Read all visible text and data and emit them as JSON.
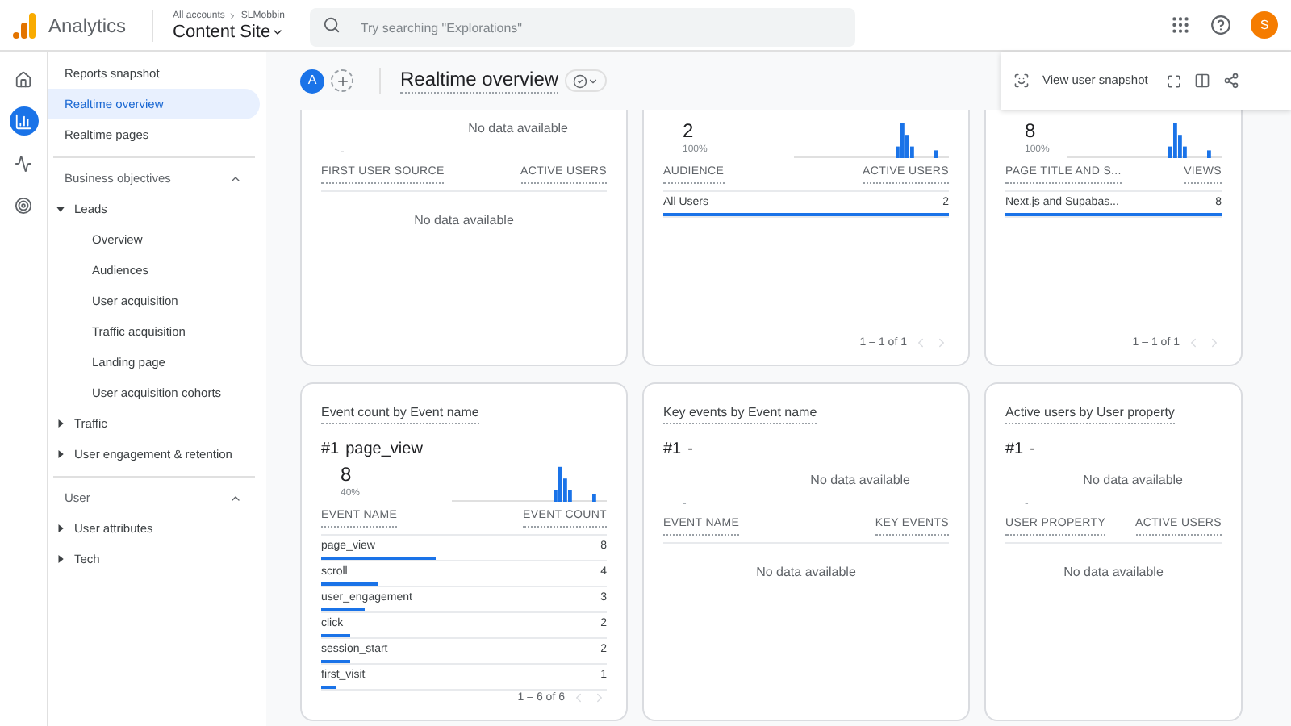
{
  "topbar": {
    "product": "Analytics",
    "breadcrumb": [
      "All accounts",
      "SLMobbin"
    ],
    "property": "Content Site",
    "search": {
      "placeholder": "Try searching \"Explorations\""
    },
    "avatar": "S"
  },
  "rail": [
    {
      "kind": "home",
      "selected": false
    },
    {
      "kind": "reports",
      "selected": true
    },
    {
      "kind": "explore",
      "selected": false
    },
    {
      "kind": "advertising",
      "selected": false
    }
  ],
  "sidebar": {
    "links": [
      {
        "label": "Reports snapshot",
        "selected": false
      },
      {
        "label": "Realtime overview",
        "selected": true
      },
      {
        "label": "Realtime pages",
        "selected": false
      }
    ],
    "sections": [
      {
        "title": "Business objectives",
        "expanded": true,
        "groups": [
          {
            "label": "Leads",
            "expanded": true,
            "children": [
              "Overview",
              "Audiences",
              "User acquisition",
              "Traffic acquisition",
              "Landing page",
              "User acquisition cohorts"
            ]
          },
          {
            "label": "Traffic",
            "expanded": false
          },
          {
            "label": "User engagement & retention",
            "expanded": false
          }
        ]
      },
      {
        "title": "User",
        "expanded": true,
        "groups": [
          {
            "label": "User attributes",
            "expanded": false
          },
          {
            "label": "Tech",
            "expanded": false
          }
        ]
      }
    ]
  },
  "header": {
    "comparison": "A",
    "title": "Realtime overview",
    "action": "View user snapshot"
  },
  "top_cards": [
    {
      "value": "-",
      "note": "No data available",
      "columns": [
        "FIRST USER SOURCE",
        "ACTIVE USERS"
      ],
      "empty": "No data available"
    },
    {
      "value": "2",
      "percent": "100%",
      "columns": [
        "AUDIENCE",
        "ACTIVE USERS"
      ],
      "rows": [
        {
          "label": "All Users",
          "value": "2",
          "level": 1
        }
      ],
      "pagination": "1 – 1 of 1"
    },
    {
      "value": "8",
      "percent": "100%",
      "columns": [
        "PAGE TITLE AND S...",
        "VIEWS"
      ],
      "rows": [
        {
          "label": "Next.js and Supabas...",
          "value": "8",
          "level": 1
        }
      ],
      "pagination": "1 – 1 of 1"
    }
  ],
  "bottom_cards": [
    {
      "title": "Event count by Event name",
      "rank": "#1",
      "rank_label": "page_view",
      "value": "8",
      "percent": "40%",
      "columns": [
        "EVENT NAME",
        "EVENT COUNT"
      ],
      "rows": [
        {
          "label": "page_view",
          "value": "8",
          "level": 0.4
        },
        {
          "label": "scroll",
          "value": "4",
          "level": 0.2
        },
        {
          "label": "user_engagement",
          "value": "3",
          "level": 0.15
        },
        {
          "label": "click",
          "value": "2",
          "level": 0.1
        },
        {
          "label": "session_start",
          "value": "2",
          "level": 0.1
        },
        {
          "label": "first_visit",
          "value": "1",
          "level": 0.05
        }
      ],
      "pagination": "1 – 6 of 6"
    },
    {
      "title": "Key events by Event name",
      "rank": "#1",
      "rank_label": "-",
      "value": "-",
      "note": "No data available",
      "columns": [
        "EVENT NAME",
        "KEY EVENTS"
      ],
      "empty": "No data available"
    },
    {
      "title": "Active users by User property",
      "rank": "#1",
      "rank_label": "-",
      "value": "-",
      "note": "No data available",
      "columns": [
        "USER PROPERTY",
        "ACTIVE USERS"
      ],
      "empty": "No data available"
    }
  ]
}
